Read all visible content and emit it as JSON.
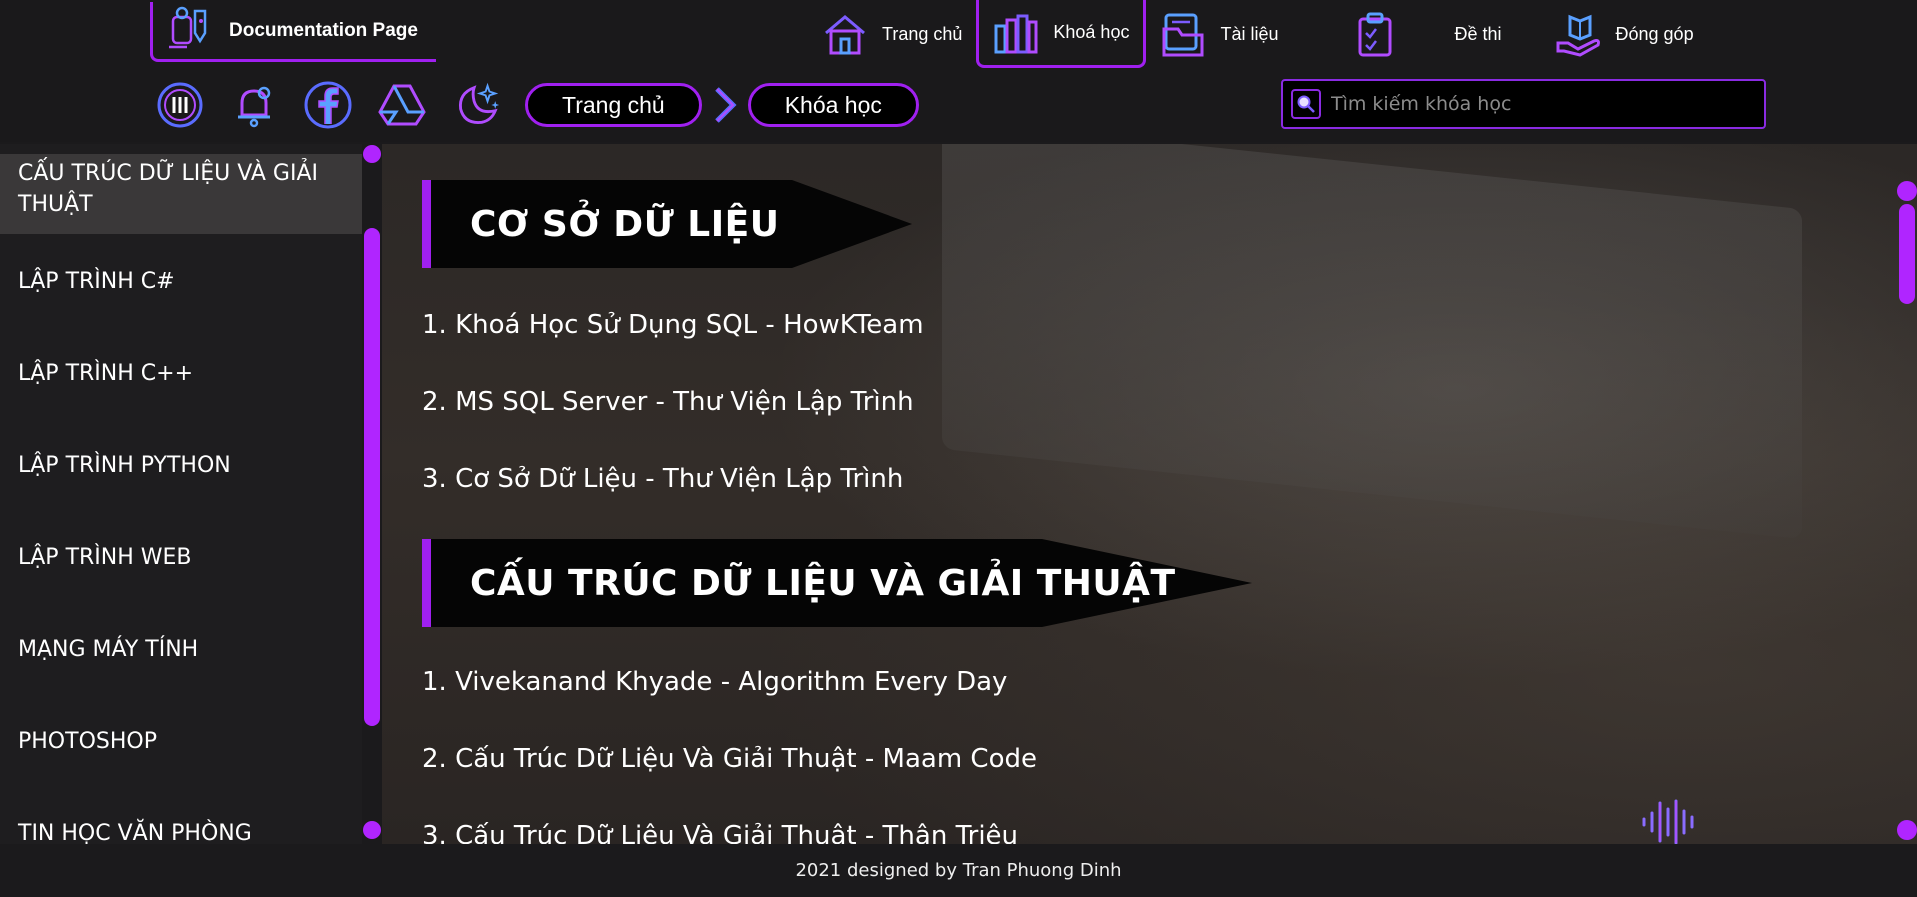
{
  "header": {
    "brand_title": "Documentation Page",
    "nav": [
      {
        "label": "Trang chủ",
        "icon": "home-icon"
      },
      {
        "label": "Khoá học",
        "icon": "books-icon",
        "active": true
      },
      {
        "label": "Tài liệu",
        "icon": "documents-icon"
      },
      {
        "label": "Đề thi",
        "icon": "clipboard-icon"
      },
      {
        "label": "Đóng góp",
        "icon": "donate-book-icon"
      }
    ],
    "toolbar_icons": [
      "menu-icon",
      "notification-bell-icon",
      "facebook-icon",
      "google-drive-icon",
      "night-mode-icon"
    ],
    "breadcrumb": [
      "Trang chủ",
      "Khóa học"
    ],
    "search_placeholder": "Tìm kiếm khóa học"
  },
  "sidebar": {
    "items": [
      {
        "label": "CẤU TRÚC DỮ LIỆU VÀ GIẢI THUẬT",
        "active": true
      },
      {
        "label": "LẬP TRÌNH C#"
      },
      {
        "label": "LẬP TRÌNH C++"
      },
      {
        "label": "LẬP TRÌNH PYTHON"
      },
      {
        "label": "LẬP TRÌNH WEB"
      },
      {
        "label": "MẠNG MÁY TÍNH"
      },
      {
        "label": "PHOTOSHOP"
      },
      {
        "label": "TIN HỌC VĂN PHÒNG"
      }
    ]
  },
  "main": {
    "sections": [
      {
        "title": "CƠ SỞ DỮ LIỆU",
        "courses": [
          "1. Khoá Học Sử Dụng SQL - HowKTeam",
          "2. MS SQL Server - Thư Viện Lập Trình",
          "3. Cơ Sở Dữ Liệu - Thư Viện Lập Trình"
        ]
      },
      {
        "title": "CẤU TRÚC DỮ LIỆU VÀ GIẢI THUẬT",
        "courses": [
          "1. Vivekanand Khyade - Algorithm Every Day",
          "2. Cấu Trúc Dữ Liệu Và Giải Thuật - Maam Code",
          "3. Cấu Trúc Dữ Liệu Và Giải Thuật - Thân Triệu"
        ]
      }
    ]
  },
  "footer": {
    "text": "2021 designed by Tran Phuong Dinh"
  },
  "colors": {
    "accent": "#a020f0",
    "background": "#1b1a1c",
    "banner": "#050505"
  }
}
